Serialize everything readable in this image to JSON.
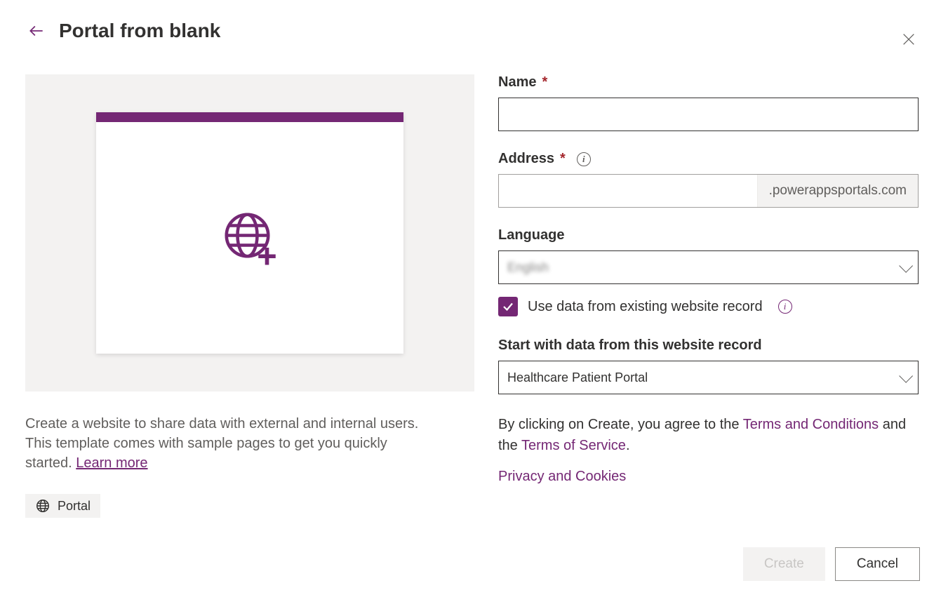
{
  "header": {
    "title": "Portal from blank"
  },
  "left": {
    "description_pre": "Create a website to share data with external and internal users. This template comes with sample pages to get you quickly started. ",
    "learn_more": "Learn more",
    "badge": "Portal"
  },
  "form": {
    "name_label": "Name",
    "name_value": "",
    "address_label": "Address",
    "address_value": "",
    "address_suffix": ".powerappsportals.com",
    "language_label": "Language",
    "language_value": "English",
    "use_existing_label": "Use data from existing website record",
    "use_existing_checked": true,
    "start_with_label": "Start with data from this website record",
    "start_with_value": "Healthcare Patient Portal",
    "agree_pre": "By clicking on Create, you agree to the ",
    "terms_conditions": "Terms and Conditions",
    "agree_mid": " and the ",
    "terms_service": "Terms of Service",
    "agree_post": ".",
    "privacy": "Privacy and Cookies"
  },
  "footer": {
    "create_label": "Create",
    "cancel_label": "Cancel"
  }
}
